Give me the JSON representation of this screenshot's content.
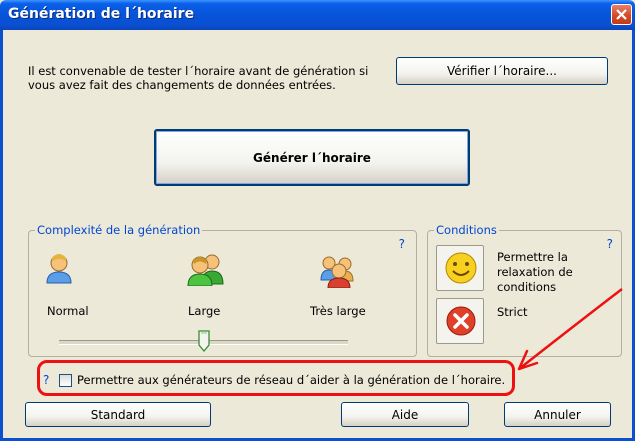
{
  "window": {
    "title": "Génération de l´horaire"
  },
  "intro": {
    "line1": "Il est convenable de tester l´horaire avant de génération si",
    "line2": "vous avez fait des changements de données entrées."
  },
  "buttons": {
    "verify": "Vérifier l´horaire...",
    "generate": "Générer l´horaire",
    "standard": "Standard",
    "help": "Aide",
    "cancel": "Annuler"
  },
  "complexity": {
    "legend": "Complexité de la génération",
    "help": "?",
    "options": [
      "Normal",
      "Large",
      "Très large"
    ],
    "selected_index": 1
  },
  "conditions": {
    "legend": "Conditions",
    "help": "?",
    "relax": {
      "line1": "Permettre la",
      "line2": "relaxation de",
      "line3": "conditions"
    },
    "strict": "Strict"
  },
  "network": {
    "help": "?",
    "label": "Permettre aux générateurs de réseau d´aider à la génération de l´horaire.",
    "checked": false
  },
  "colors": {
    "titlebar": "#0754d9",
    "accent_text": "#0046d5",
    "annotation": "#ee1111",
    "face": "#ece9d8"
  }
}
